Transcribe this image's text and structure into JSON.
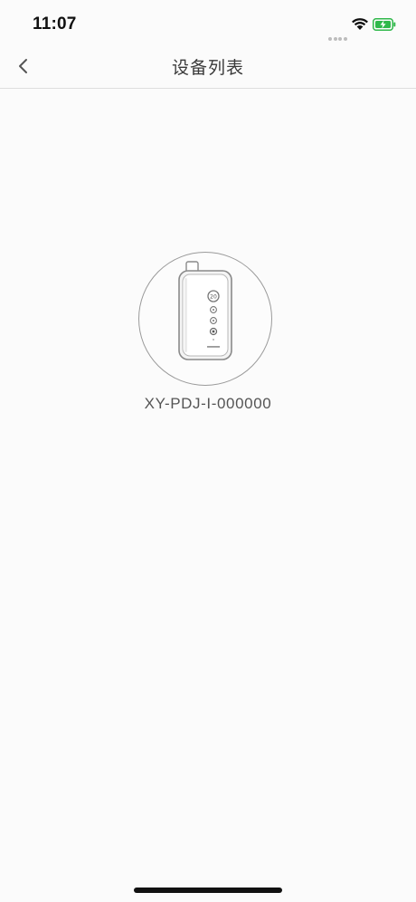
{
  "status_bar": {
    "time": "11:07",
    "icons": [
      "signal-dots-icon",
      "wifi-icon",
      "battery-charging-icon"
    ],
    "battery_color": "#2fb84a"
  },
  "header": {
    "title": "设备列表",
    "back_icon": "chevron-left-icon"
  },
  "devices": [
    {
      "name": "XY-PDJ-I-000000",
      "image_icon": "portable-device-icon"
    }
  ],
  "colors": {
    "background": "#fbfbfb",
    "divider": "#dedede",
    "circle_border": "#9a9a9a",
    "text": "#555555"
  }
}
